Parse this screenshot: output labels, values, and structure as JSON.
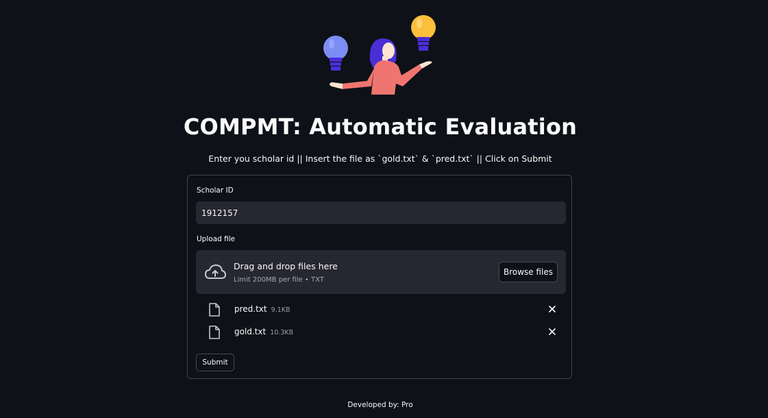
{
  "header": {
    "title": "COMPMT: Automatic Evaluation",
    "subtitle": "Enter you scholar id || Insert the file as `gold.txt` & `pred.txt` || Click on Submit",
    "hero_image": "woman-with-lightbulbs-illustration"
  },
  "form": {
    "scholar_label": "Scholar ID",
    "scholar_value": "1912157",
    "upload_label": "Upload file",
    "dropzone": {
      "icon": "cloud-upload-icon",
      "main_text": "Drag and drop files here",
      "sub_text": "Limit 200MB per file • TXT",
      "browse_label": "Browse files"
    },
    "files": [
      {
        "name": "pred.txt",
        "size": "9.1KB",
        "icon": "file-icon"
      },
      {
        "name": "gold.txt",
        "size": "10.3KB",
        "icon": "file-icon"
      }
    ],
    "submit_label": "Submit"
  },
  "footer": {
    "text": "Developed by: Pro"
  },
  "colors": {
    "background": "#0e1117",
    "input_bg": "#262730",
    "text": "#fafafa",
    "bulb_blue": "#7b8df5",
    "bulb_yellow": "#fbbf3c",
    "shirt": "#f07570",
    "hair": "#4a2ed8"
  }
}
